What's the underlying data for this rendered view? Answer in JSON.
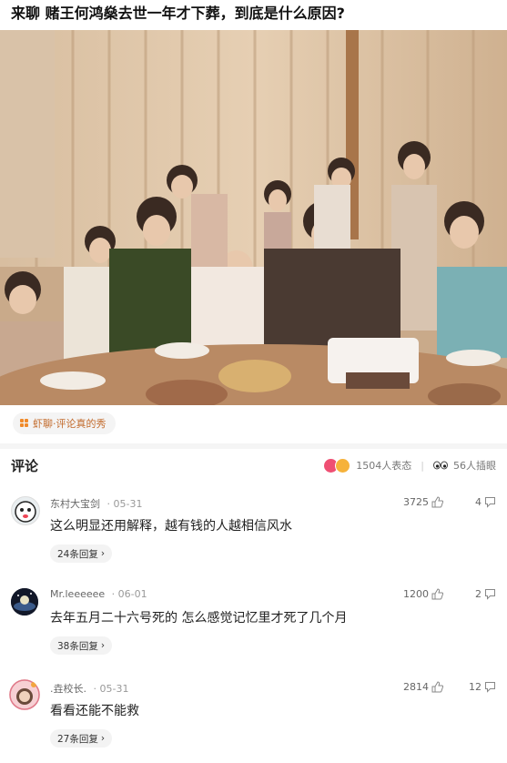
{
  "post": {
    "title": "来聊 赌王何鸿燊去世一年才下葬，到底是什么原因?"
  },
  "topic_tag": {
    "icon": "shrimp-chat-icon",
    "label": "虾聊·评论真的秀"
  },
  "comments_section": {
    "title": "评论",
    "reactions_count": "1504人表态",
    "inserted_count": "56人插眼"
  },
  "comments": [
    {
      "user": "东村大宝剑",
      "date": "· 05-31",
      "text": "这么明显还用解释，越有钱的人越相信风水",
      "likes": "3725",
      "dislikes": "4",
      "replies": "24条回复"
    },
    {
      "user": "Mr.leeeeee",
      "date": "· 06-01",
      "text": "去年五月二十六号死的 怎么感觉记忆里才死了几个月",
      "likes": "1200",
      "dislikes": "2",
      "replies": "38条回复"
    },
    {
      "user": ".垚校长.",
      "date": "· 05-31",
      "text": "看看还能不能救",
      "likes": "2814",
      "dislikes": "12",
      "replies": "27条回复"
    }
  ],
  "colors": {
    "tag_text": "#c26a2b",
    "tag_icon": "#f08a2a",
    "text_primary": "#222222",
    "text_secondary": "#999999"
  }
}
